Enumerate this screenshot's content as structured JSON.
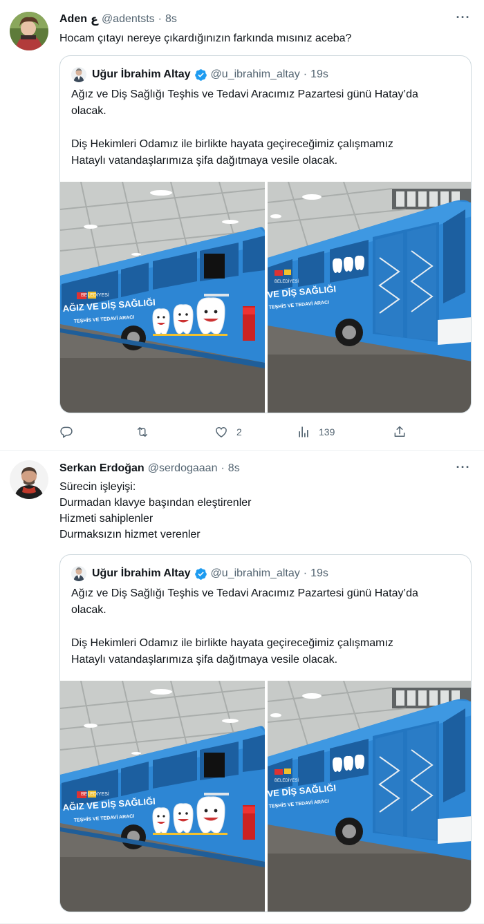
{
  "tweets": [
    {
      "author_name": "Aden",
      "author_flag": "ع",
      "author_handle": "@adentsts",
      "separator": "·",
      "time": "8s",
      "text_lines": [
        "Hocam çıtayı nereye çıkardığınızın farkında mısınız aceba?"
      ],
      "quote": {
        "author_name": "Uğur İbrahim Altay",
        "author_handle": "@u_ibrahim_altay",
        "separator": "·",
        "time": "19s",
        "paragraph1": [
          "Ağız ve Diş Sağlığı Teşhis ve Tedavi Aracımız Pazartesi günü Hatay’da",
          "olacak."
        ],
        "paragraph2": [
          "Diş Hekimleri Odamız ile birlikte hayata geçireceğimiz çalışmamız",
          "Hataylı vatandaşlarımıza şifa dağıtmaya vesile olacak."
        ],
        "bus_text": {
          "line1": "AĞIZ VE DİŞ SAĞLIĞI",
          "line2": "TEŞHİS VE TEDAVİ ARACI",
          "line1_right": "VE DİŞ SAĞLIĞI",
          "line2_right": "TEŞHİS VE TEDAVİ ARACI",
          "logo": "BELEDİYESİ"
        }
      },
      "actions": {
        "reply_count": "",
        "retweet_count": "",
        "like_count": "2",
        "view_count": "139"
      }
    },
    {
      "author_name": "Serkan Erdoğan",
      "author_handle": "@serdogaaan",
      "separator": "·",
      "time": "8s",
      "text_lines": [
        "Sürecin işleyişi:",
        "Durmadan klavye başından eleştirenler",
        "Hizmeti sahiplenler",
        "Durmaksızın hizmet verenler"
      ],
      "quote": {
        "author_name": "Uğur İbrahim Altay",
        "author_handle": "@u_ibrahim_altay",
        "separator": "·",
        "time": "19s",
        "paragraph1": [
          "Ağız ve Diş Sağlığı Teşhis ve Tedavi Aracımız Pazartesi günü Hatay’da",
          "olacak."
        ],
        "paragraph2": [
          "Diş Hekimleri Odamız ile birlikte hayata geçireceğimiz çalışmamız",
          "Hataylı vatandaşlarımıza şifa dağıtmaya vesile olacak."
        ],
        "bus_text": {
          "line1": "AĞIZ VE DİŞ SAĞLIĞI",
          "line2": "TEŞHİS VE TEDAVİ ARACI",
          "line1_right": "VE DİŞ SAĞLIĞI",
          "line2_right": "TEŞHİS VE TEDAVİ ARACI",
          "logo": "BELEDİYESİ"
        }
      }
    }
  ],
  "icons": {
    "more": "more-options-icon",
    "verified": "verified-badge-icon",
    "reply": "reply-icon",
    "retweet": "retweet-icon",
    "like": "heart-icon",
    "views": "views-icon",
    "share": "share-icon"
  },
  "colors": {
    "verified": "#1d9bf0",
    "bus_blue": "#2f8fd8",
    "muted_text": "#536471"
  }
}
